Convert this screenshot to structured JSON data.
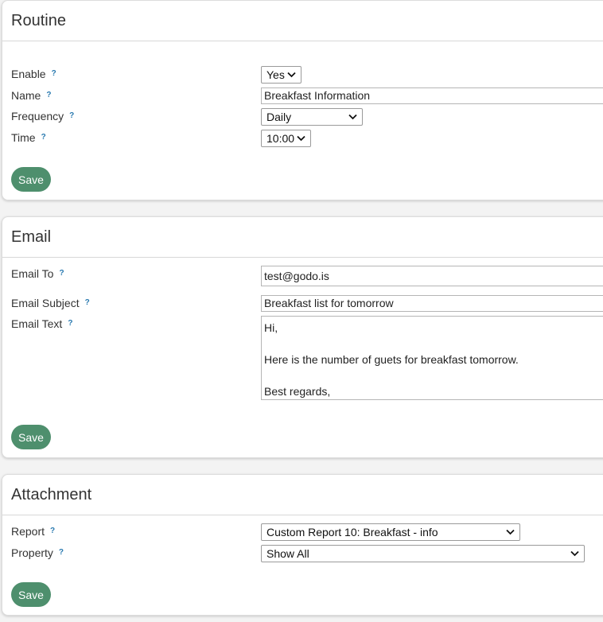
{
  "routine": {
    "title": "Routine",
    "enable_label": "Enable",
    "enable_value": "Yes",
    "name_label": "Name",
    "name_value": "Breakfast Information",
    "frequency_label": "Frequency",
    "frequency_value": "Daily",
    "time_label": "Time",
    "time_value": "10:00",
    "save_label": "Save"
  },
  "email": {
    "title": "Email",
    "to_label": "Email To",
    "to_value": "test@godo.is",
    "subject_label": "Email Subject",
    "subject_value": "Breakfast list for tomorrow",
    "text_label": "Email Text",
    "text_value": "Hi,\n\nHere is the number of guets for breakfast tomorrow.\n\nBest regards,",
    "save_label": "Save"
  },
  "attachment": {
    "title": "Attachment",
    "report_label": "Report",
    "report_value": "Custom Report 10: Breakfast - info",
    "property_label": "Property",
    "property_value": "Show All",
    "save_label": "Save"
  },
  "help_glyph": "?",
  "colors": {
    "accent": "#4e8f6d",
    "help": "#2a7ab0",
    "background": "#f3f3f3"
  }
}
